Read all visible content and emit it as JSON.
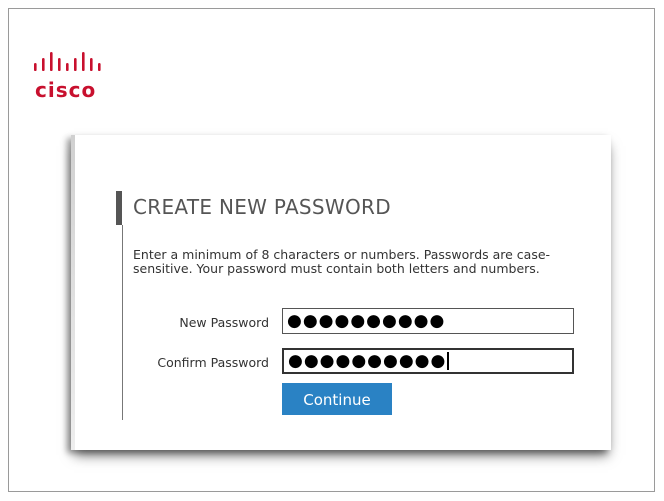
{
  "brand": {
    "logo_text": "cisco"
  },
  "form": {
    "title": "CREATE NEW PASSWORD",
    "description": "Enter a minimum of 8 characters or numbers. Passwords are case-sensitive. Your password must contain both letters and numbers.",
    "new_password": {
      "label": "New Password",
      "masked_value": "●●●●●●●●●●"
    },
    "confirm_password": {
      "label": "Confirm Password",
      "masked_value": "●●●●●●●●●●"
    },
    "continue_label": "Continue"
  },
  "colors": {
    "brand_red": "#c8102e",
    "button_blue": "#2a82c4"
  }
}
